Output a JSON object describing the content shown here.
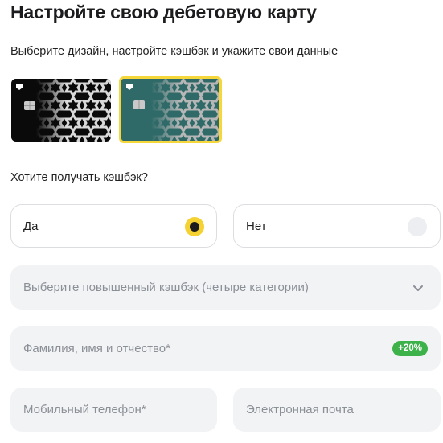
{
  "header": {
    "title": "Настройте свою дебетовую карту",
    "subtitle": "Выберите дизайн, настройте кэшбэк и укажите свои данные"
  },
  "card_designs": {
    "items": [
      {
        "design": "black",
        "color": "#0a0a0a",
        "selected": false
      },
      {
        "design": "green",
        "color": "#2f6a68",
        "selected": true
      }
    ],
    "selected_border_color": "#f5d73b"
  },
  "cashback": {
    "question": "Хотите получать кэшбэк?",
    "options": [
      {
        "label": "Да",
        "selected": true
      },
      {
        "label": "Нет",
        "selected": false
      }
    ]
  },
  "form": {
    "category_select": {
      "placeholder": "Выберите повышенный кэшбэк (четыре категории)",
      "icon": "chevron-down-icon"
    },
    "full_name": {
      "placeholder": "Фамилия, имя и отчество*",
      "badge": "+20%",
      "badge_color": "#3db14a"
    },
    "phone": {
      "placeholder": "Мобильный телефон*"
    },
    "email": {
      "placeholder": "Электронная почта"
    }
  },
  "colors": {
    "accent": "#f5d231",
    "field_background": "#f2f3f5"
  }
}
